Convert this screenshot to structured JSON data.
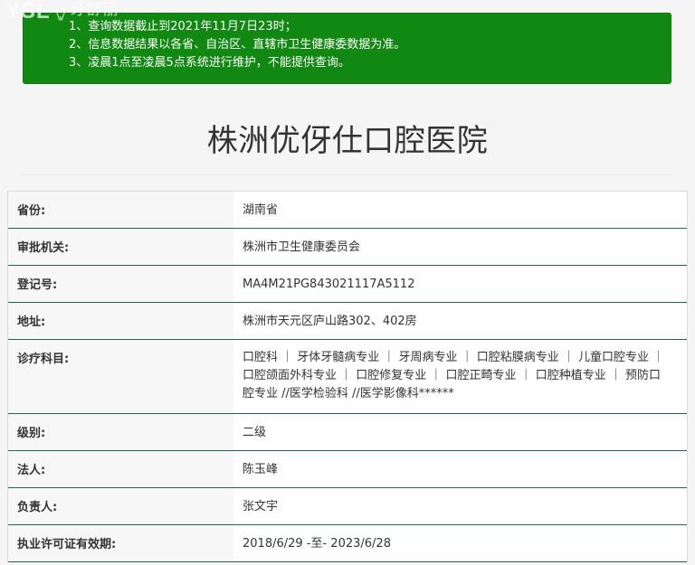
{
  "watermark": {
    "brand": "YSL",
    "chinese": "牙舒丽"
  },
  "notice": {
    "lines": [
      "1、查询数据截止到2021年11月7日23时；",
      "2、信息数据结果以各省、自治区、直辖市卫生健康委数据为准。",
      "3、凌晨1点至凌晨5点系统进行维护，不能提供查询。"
    ],
    "background_color": "#118811"
  },
  "title": "株洲优伢仕口腔医院",
  "details": {
    "rows": [
      {
        "label": "省份:",
        "value": "湖南省"
      },
      {
        "label": "审批机关:",
        "value": "株洲市卫生健康委员会"
      },
      {
        "label": "登记号:",
        "value": "MA4M21PG843021117A5112"
      },
      {
        "label": "地址:",
        "value": "株洲市天元区庐山路302、402房"
      },
      {
        "label": "诊疗科目:",
        "value": "口腔科 ｜ 牙体牙髓病专业 ｜ 牙周病专业 ｜ 口腔粘膜病专业 ｜ 儿童口腔专业 ｜ 口腔颌面外科专业 ｜ 口腔修复专业 ｜ 口腔正畸专业 ｜ 口腔种植专业 ｜ 预防口腔专业 //医学检验科 //医学影像科******"
      },
      {
        "label": "级别:",
        "value": "二级"
      },
      {
        "label": "法人:",
        "value": "陈玉峰"
      },
      {
        "label": "负责人:",
        "value": "张文宇"
      },
      {
        "label": "执业许可证有效期:",
        "value": "2018/6/29 -至- 2023/6/28"
      }
    ]
  },
  "colors": {
    "row_divider": "#1f6a44"
  }
}
